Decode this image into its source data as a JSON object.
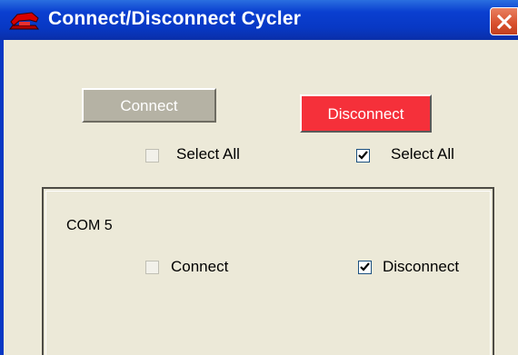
{
  "window": {
    "title": "Connect/Disconnect Cycler",
    "icons": {
      "app": "red-phone-icon",
      "close": "close-icon"
    }
  },
  "buttons": {
    "connect": {
      "label": "Connect",
      "enabled": false
    },
    "disconnect": {
      "label": "Disconnect",
      "enabled": true,
      "color": "#f5303a"
    }
  },
  "select_all": {
    "connect": {
      "label": "Select All",
      "checked": false,
      "enabled": false
    },
    "disconnect": {
      "label": "Select All",
      "checked": true,
      "enabled": true
    }
  },
  "ports": [
    {
      "name": "COM 5",
      "connect": {
        "label": "Connect",
        "checked": false,
        "enabled": false
      },
      "disconnect": {
        "label": "Disconnect",
        "checked": true,
        "enabled": true
      }
    }
  ]
}
